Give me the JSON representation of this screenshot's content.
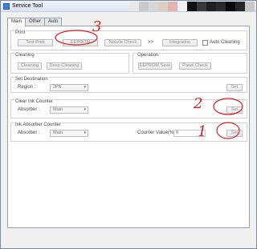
{
  "window": {
    "title": "Service Tool"
  },
  "title_colors": [
    "#e8e8e8",
    "#c9c9c9",
    "#d6d6d6",
    "#d9d0c0",
    "#e2b4b4",
    "#f0f0f0",
    "#101010",
    "#3a3a3a",
    "#1f1f1f",
    "#2a2a2a",
    "#0a0a0a",
    "#262626",
    "#c8c8c8"
  ],
  "tabs": [
    {
      "label": "Main",
      "active": true
    },
    {
      "label": "Other",
      "active": false
    },
    {
      "label": "Auto",
      "active": false
    }
  ],
  "print": {
    "title": "Print",
    "test_print": "Test Print",
    "eeprom": "EEPROM",
    "nozzle_check": "Nozzle Check",
    "arrows": ">>",
    "integration": "Integration",
    "auto_cleaning": "Auto Cleaning"
  },
  "cleaning": {
    "title": "Cleaning",
    "cleaning": "Cleaning",
    "deep_cleaning": "Deep Cleaning"
  },
  "operation": {
    "title": "Operation",
    "eeprom_save": "EEPROM Save",
    "panel_check": "Panel Check"
  },
  "set_destination": {
    "title": "Set Destination",
    "region_label": "Region :",
    "region_value": "JPN",
    "set": "Set"
  },
  "clear_ink": {
    "title": "Clear Ink Counter",
    "absorber_label": "Absorber :",
    "absorber_value": "Main",
    "set": "Set"
  },
  "ink_absorber": {
    "title": "Ink Absorber Counter",
    "absorber_label": "Absorber :",
    "absorber_value": "Main",
    "counter_label": "Counter Value(%) :",
    "counter_value": "0",
    "set": "Set"
  },
  "annotations": {
    "one": "1",
    "two": "2",
    "three": "3"
  },
  "colors": {
    "annotation": "#e01a1a"
  }
}
